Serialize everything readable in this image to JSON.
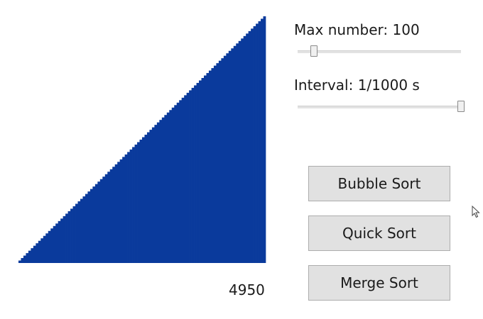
{
  "sort_display": {
    "values": [
      1,
      2,
      3,
      4,
      5,
      6,
      7,
      8,
      9,
      10,
      11,
      12,
      13,
      14,
      15,
      16,
      17,
      18,
      19,
      20,
      21,
      22,
      23,
      24,
      25,
      26,
      27,
      28,
      29,
      30,
      31,
      32,
      33,
      34,
      35,
      36,
      37,
      38,
      39,
      40,
      41,
      42,
      43,
      44,
      45,
      46,
      47,
      48,
      49,
      50,
      51,
      52,
      53,
      54,
      55,
      56,
      57,
      58,
      59,
      60,
      61,
      62,
      63,
      64,
      65,
      66,
      67,
      68,
      69,
      70,
      71,
      72,
      73,
      74,
      75,
      76,
      77,
      78,
      79,
      80,
      81,
      82,
      83,
      84,
      85,
      86,
      87,
      88,
      89,
      90,
      91,
      92,
      93,
      94,
      95,
      96,
      97,
      98,
      99,
      100
    ],
    "max_value": 100,
    "bar_color": "#0a3a9c",
    "comparisons": "4950"
  },
  "controls": {
    "max_number_label": "Max number: 100",
    "max_number_value": 100,
    "max_number_fraction": 0.06,
    "interval_label": "Interval: 1/1000 s",
    "interval_fraction": 1.0
  },
  "buttons": {
    "bubble_sort": "Bubble Sort",
    "quick_sort": "Quick Sort",
    "merge_sort": "Merge Sort"
  },
  "icons": {
    "cursor": "mouse-pointer-icon"
  }
}
